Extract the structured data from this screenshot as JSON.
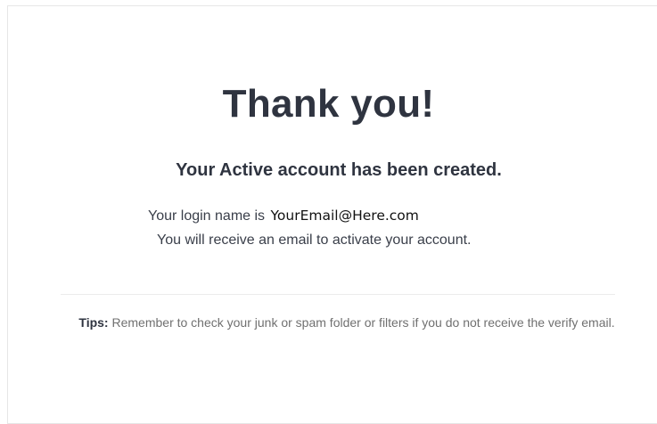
{
  "confirmation": {
    "heading": "Thank you!",
    "subheading": "Your Active account has been created.",
    "login_prefix": "Your login name is",
    "login_email": "YourEmail@Here.com",
    "activate_message": "You will receive an email to activate your account.",
    "tips_label": "Tips:",
    "tips_text": " Remember to check your junk or spam folder or filters if you do not receive the verify email."
  },
  "colors": {
    "heading": "#2f3440",
    "body_text": "#3a3f4a",
    "muted_text": "#707070",
    "divider": "#ececec"
  }
}
